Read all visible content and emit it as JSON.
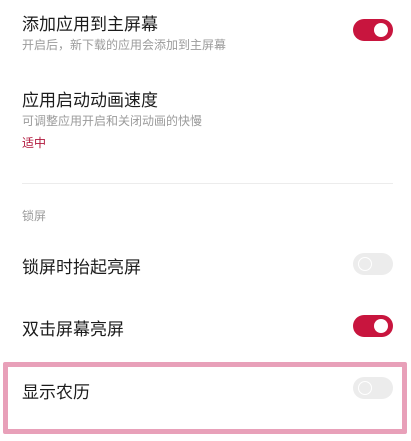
{
  "colors": {
    "toggle_on": "#c8153e",
    "toggle_off": "#ececec",
    "value_accent": "#b0153a",
    "highlight_border": "#e8a0b9"
  },
  "settings": {
    "add_to_home": {
      "title": "添加应用到主屏幕",
      "subtitle": "开启后，新下载的应用会添加到主屏幕",
      "enabled": true
    },
    "animation_speed": {
      "title": "应用启动动画速度",
      "subtitle": "可调整应用开启和关闭动画的快慢",
      "value": "适中"
    },
    "lock_section": {
      "header": "锁屏"
    },
    "raise_to_wake": {
      "title": "锁屏时抬起亮屏",
      "enabled": false
    },
    "double_tap_wake": {
      "title": "双击屏幕亮屏",
      "enabled": true
    },
    "show_lunar": {
      "title": "显示农历",
      "enabled": false
    }
  }
}
